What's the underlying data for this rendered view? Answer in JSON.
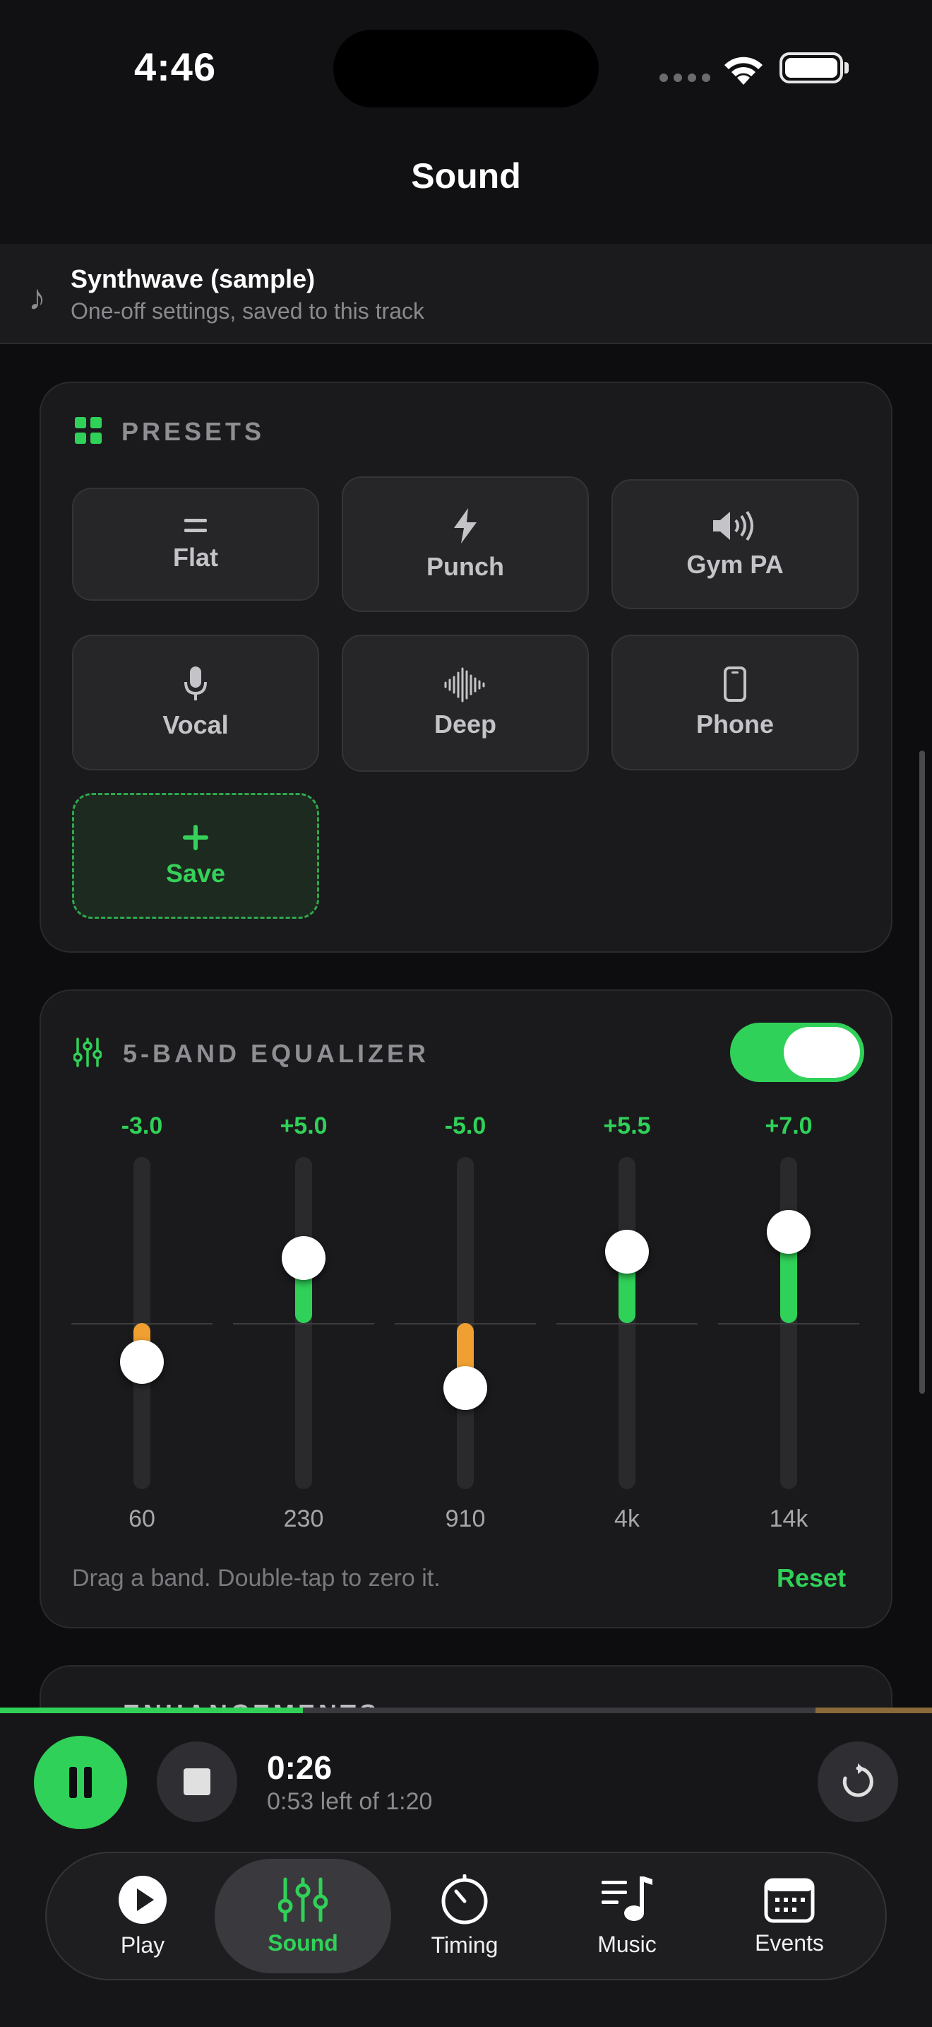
{
  "status_bar": {
    "time": "4:46"
  },
  "header": {
    "title": "Sound"
  },
  "track": {
    "name": "Synthwave (sample)",
    "subtitle": "One-off settings, saved to this track"
  },
  "presets": {
    "title": "PRESETS",
    "items": [
      {
        "label": "Flat",
        "icon": "equals-icon"
      },
      {
        "label": "Punch",
        "icon": "bolt-icon"
      },
      {
        "label": "Gym PA",
        "icon": "speaker-icon"
      },
      {
        "label": "Vocal",
        "icon": "microphone-icon"
      },
      {
        "label": "Deep",
        "icon": "waveform-icon"
      },
      {
        "label": "Phone",
        "icon": "phone-icon"
      }
    ],
    "save_label": "Save"
  },
  "equalizer": {
    "title": "5-BAND EQUALIZER",
    "enabled": true,
    "range_db": [
      -12,
      12
    ],
    "bands": [
      {
        "freq": "60",
        "value": "-3.0",
        "gain": -3.0
      },
      {
        "freq": "230",
        "value": "+5.0",
        "gain": 5.0
      },
      {
        "freq": "910",
        "value": "-5.0",
        "gain": -5.0
      },
      {
        "freq": "4k",
        "value": "+5.5",
        "gain": 5.5
      },
      {
        "freq": "14k",
        "value": "+7.0",
        "gain": 7.0
      }
    ],
    "hint": "Drag a band. Double-tap to zero it.",
    "reset_label": "Reset",
    "colors": {
      "boost": "#30d158",
      "cut": "#f0a030"
    }
  },
  "next_card": {
    "title": "ENHANCEMENTS"
  },
  "player": {
    "elapsed": "0:26",
    "remaining": "0:53 left of 1:20",
    "progress": 0.325
  },
  "tabs": [
    {
      "label": "Play",
      "icon": "play-icon"
    },
    {
      "label": "Sound",
      "icon": "sliders-icon",
      "active": true
    },
    {
      "label": "Timing",
      "icon": "timer-icon"
    },
    {
      "label": "Music",
      "icon": "music-note-icon"
    },
    {
      "label": "Events",
      "icon": "calendar-icon"
    }
  ],
  "accent_color": "#30d158"
}
